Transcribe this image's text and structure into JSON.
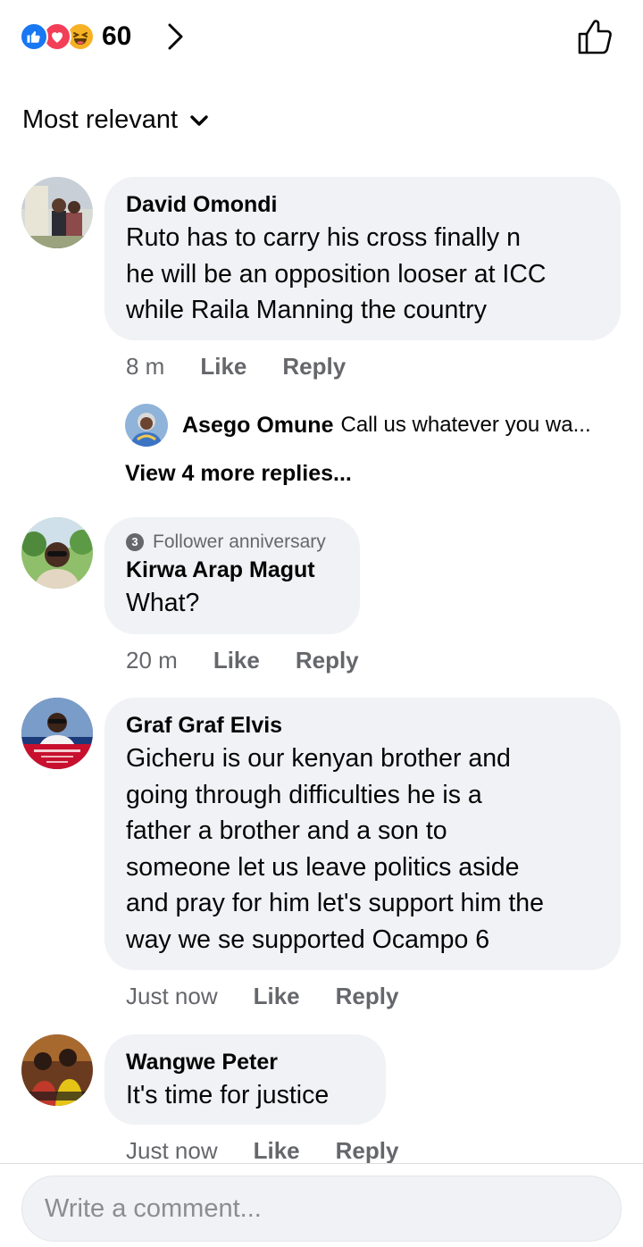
{
  "reactions": {
    "icons": [
      "like-icon",
      "love-icon",
      "haha-icon"
    ],
    "count": "60"
  },
  "sort": {
    "label": "Most relevant"
  },
  "comments": [
    {
      "author": "David Omondi",
      "lines": [
        "Ruto has to carry his cross finally n",
        "he will be an opposition looser at ICC",
        "while Raila Manning the country"
      ],
      "time": "8 m",
      "like": "Like",
      "reply": "Reply",
      "reply_preview": {
        "author": "Asego Omune",
        "text": "Call us whatever you wa..."
      },
      "view_more": "View 4 more replies..."
    },
    {
      "badge": "Follower anniversary",
      "badge_number": "3",
      "author": "Kirwa Arap Magut",
      "lines": [
        "What?"
      ],
      "time": "20 m",
      "like": "Like",
      "reply": "Reply"
    },
    {
      "author": "Graf Graf Elvis",
      "lines": [
        "Gicheru is our kenyan brother and",
        "going through difficulties he is a",
        "father a brother and a son to",
        "someone let us leave politics aside",
        "and pray for him let's support him the",
        "way we se supported Ocampo 6"
      ],
      "time": "Just now",
      "like": "Like",
      "reply": "Reply"
    },
    {
      "author": "Wangwe Peter",
      "lines": [
        "It's time for justice"
      ],
      "time": "Just now",
      "like": "Like",
      "reply": "Reply"
    }
  ],
  "composer": {
    "placeholder": "Write a comment..."
  },
  "colors": {
    "like_blue": "#1877f2",
    "love_red": "#f33e58",
    "haha_yellow": "#f7b125",
    "bubble_bg": "#f0f2f5",
    "meta_gray": "#65676b"
  }
}
